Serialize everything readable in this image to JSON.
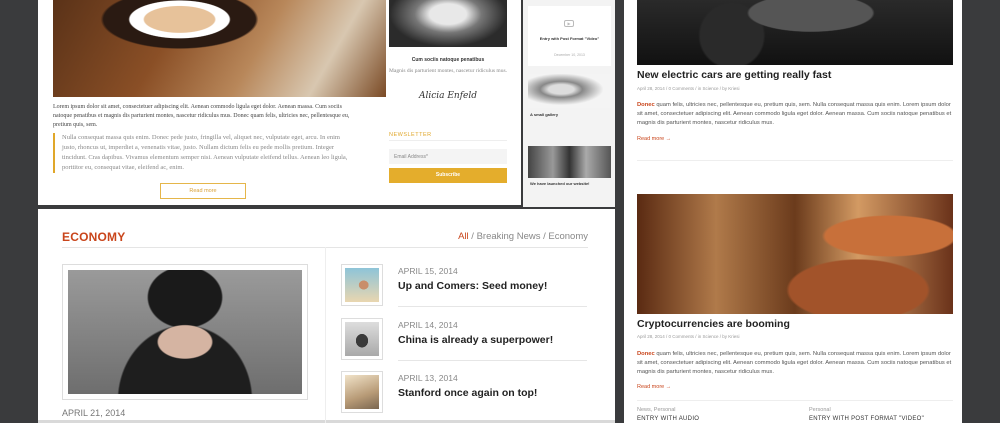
{
  "blog": {
    "text1": "Lorem ipsum dolor sit amet, consectetuer adipiscing elit. Aenean commodo ligula eget dolor. Aenean massa. Cum sociis natoque penatibus et magnis dis parturient montes, nascetur ridiculus mus. Donec quam felis, ultricies nec, pellentesque eu, pretium quis, sem.",
    "quote": "Nulla consequat massa quis enim. Donec pede justo, fringilla vel, aliquet nec, vulputate eget, arcu. In enim justo, rhoncus ut, imperdiet a, venenatis vitae, justo. Nullam dictum felis eu pede mollis pretium. Integer tincidunt. Cras dapibus. Vivamus elementum semper nisi. Aenean vulputate eleifend tellus. Aenean leo ligula, porttitor eu, consequat vitae, eleifend ac, enim.",
    "read_more": "Read more"
  },
  "author": {
    "name": "Cum sociis natoque penatibus",
    "desc": "Magnis dis parturient montes, nascetur ridiculus mus.",
    "signature": "Alicia Enfeld"
  },
  "newsletter": {
    "title": "NEWSLETTER",
    "placeholder": "Email Address*",
    "button": "Subscribe"
  },
  "mobile": {
    "item1_title": "Entry with Post Format \"Video\"",
    "item1_date": "December 10, 2013",
    "item2_title": "A small gallery",
    "item3_title": "We have launched our website!"
  },
  "economy": {
    "title": "ECONOMY",
    "crumbs": [
      "All",
      "Breaking News",
      "Economy"
    ],
    "main_date": "APRIL 21, 2014",
    "items": [
      {
        "date": "APRIL 15, 2014",
        "title": "Up and Comers: Seed money!"
      },
      {
        "date": "APRIL 14, 2014",
        "title": "China is already a superpower!"
      },
      {
        "date": "APRIL 13, 2014",
        "title": "Stanford once again on top!"
      }
    ]
  },
  "right": {
    "post1": {
      "title": "New electric cars are getting really fast",
      "meta": "April 28, 2014  /  0 Comments  /  in Science  /  by Kriesi",
      "lead": "Donec",
      "excerpt": " quam felis, ultricies nec, pellentesque eu, pretium quis, sem. Nulla consequat massa quis enim. Lorem ipsum dolor sit amet, consectetuer adipiscing elit. Aenean commodo ligula eget dolor. Aenean massa. Cum sociis natoque penatibus et magnis dis parturient montes, nascetur ridiculus mus.",
      "more": "Read more →"
    },
    "post2": {
      "title": "Cryptocurrencies are booming",
      "meta": "April 28, 2014  /  0 Comments  /  in Science  /  by Kriesi",
      "lead": "Donec",
      "excerpt": " quam felis, ultricies nec, pellentesque eu, pretium quis, sem. Nulla consequat massa quis enim. Lorem ipsum dolor sit amet, consectetuer adipiscing elit. Aenean commodo ligula eget dolor. Aenean massa. Cum sociis natoque penatibus et magnis dis parturient montes, nascetur ridiculus mus.",
      "more": "Read more →"
    },
    "footer": [
      {
        "cat": "News, Personal",
        "title": "ENTRY WITH AUDIO"
      },
      {
        "cat": "Personal",
        "title": "ENTRY WITH POST FORMAT \"VIDEO\""
      }
    ]
  },
  "colors": {
    "accent": "#c9451b",
    "gold": "#e4ad2c",
    "background": "#3a3b3d"
  }
}
